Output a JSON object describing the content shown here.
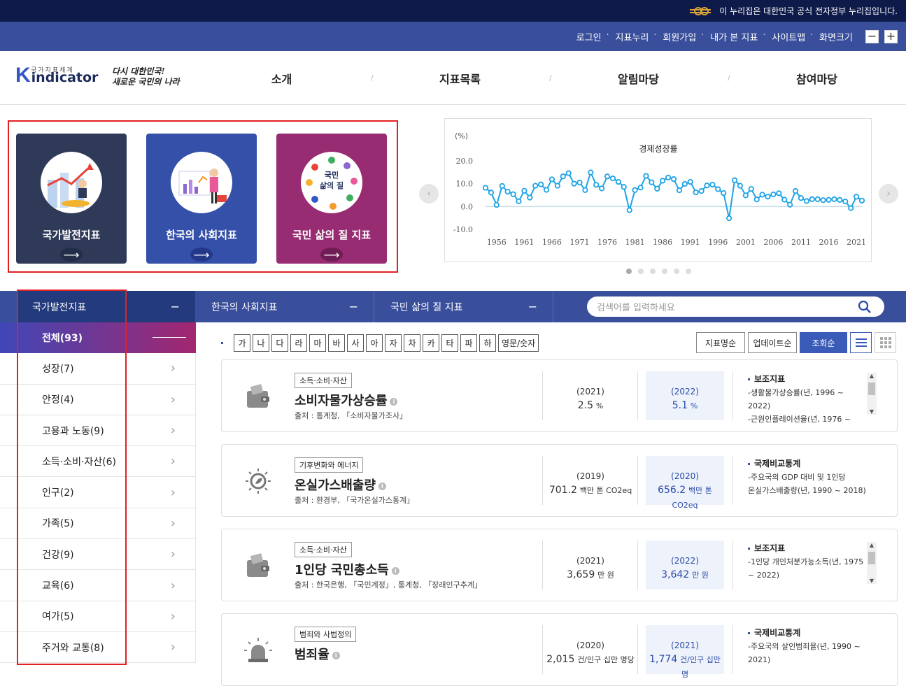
{
  "topbar": {
    "notice": "이 누리집은 대한민국 공식 전자정부 누리집입니다."
  },
  "util": {
    "links": [
      "로그인",
      "지표누리",
      "회원가입",
      "내가 본 지표",
      "사이트맵",
      "화면크기"
    ],
    "zoom_out": "−",
    "zoom_in": "+"
  },
  "header": {
    "logo_sub": "국가지표체계",
    "logo_k": "K",
    "logo_name": "indicator",
    "slogan_1": "다시 대한민국!",
    "slogan_2": "새로운 국민의 나라",
    "nav": [
      "소개",
      "지표목록",
      "알림마당",
      "참여마당"
    ]
  },
  "cards": [
    {
      "title": "국가발전지표",
      "color": "#2f3a58"
    },
    {
      "title": "한국의 사회지표",
      "color": "#3450a8"
    },
    {
      "title": "국민 삶의 질 지표",
      "color": "#972c72",
      "circle_text_1": "국민",
      "circle_text_2": "삶의 질"
    }
  ],
  "chart_data": {
    "type": "line",
    "title": "경제성장률",
    "ylabel": "(%)",
    "ylim": [
      -10,
      20
    ],
    "yticks": [
      "20.0",
      "10.0",
      "0.0",
      "-10.0"
    ],
    "xticks": [
      "1956",
      "1961",
      "1966",
      "1971",
      "1976",
      "1981",
      "1986",
      "1991",
      "1996",
      "2001",
      "2006",
      "2011",
      "2016",
      "2021"
    ],
    "x": [
      1954,
      1955,
      1956,
      1957,
      1958,
      1959,
      1960,
      1961,
      1962,
      1963,
      1964,
      1965,
      1966,
      1967,
      1968,
      1969,
      1970,
      1971,
      1972,
      1973,
      1974,
      1975,
      1976,
      1977,
      1978,
      1979,
      1980,
      1981,
      1982,
      1983,
      1984,
      1985,
      1986,
      1987,
      1988,
      1989,
      1990,
      1991,
      1992,
      1993,
      1994,
      1995,
      1996,
      1997,
      1998,
      1999,
      2000,
      2001,
      2002,
      2003,
      2004,
      2005,
      2006,
      2007,
      2008,
      2009,
      2010,
      2011,
      2012,
      2013,
      2014,
      2015,
      2016,
      2017,
      2018,
      2019,
      2020,
      2021,
      2022
    ],
    "values": [
      8.2,
      6.1,
      0.7,
      9.0,
      6.5,
      5.4,
      2.3,
      6.9,
      3.9,
      9.1,
      9.7,
      7.3,
      11.9,
      9.1,
      13.2,
      14.6,
      10.0,
      10.5,
      7.2,
      14.9,
      9.5,
      7.9,
      13.2,
      12.3,
      10.8,
      8.6,
      -1.6,
      7.2,
      8.3,
      13.4,
      10.6,
      7.8,
      11.3,
      12.7,
      12.0,
      7.1,
      9.9,
      10.8,
      6.2,
      6.8,
      9.2,
      9.6,
      7.6,
      5.9,
      -5.1,
      11.5,
      9.1,
      4.9,
      7.7,
      3.1,
      5.2,
      4.3,
      5.3,
      5.8,
      3.0,
      0.8,
      6.8,
      3.7,
      2.4,
      3.2,
      3.2,
      2.8,
      2.9,
      3.2,
      2.9,
      2.2,
      -0.7,
      4.3,
      2.6
    ],
    "color": "#1ea3e6",
    "slides": 6,
    "active_slide": 0
  },
  "tabs": [
    {
      "label": "국가발전지표",
      "icon": "−"
    },
    {
      "label": "한국의 사회지표",
      "icon": "−"
    },
    {
      "label": "국민 삶의 질 지표",
      "icon": "−"
    }
  ],
  "search": {
    "placeholder": "검색어를 입력하세요"
  },
  "sidebar": {
    "items": [
      "전체(93)",
      "성장(7)",
      "안정(4)",
      "고용과 노동(9)",
      "소득·소비·자산(6)",
      "인구(2)",
      "가족(5)",
      "건강(9)",
      "교육(6)",
      "여가(5)",
      "주거와 교통(8)"
    ]
  },
  "alpha": [
    "가",
    "나",
    "다",
    "라",
    "마",
    "바",
    "사",
    "아",
    "자",
    "차",
    "카",
    "타",
    "파",
    "하",
    "영문/숫자"
  ],
  "sort": {
    "name": "지표명순",
    "update": "업데이트순",
    "views": "조회순"
  },
  "items": [
    {
      "category": "소득·소비·자산",
      "name": "소비자물가상승률",
      "source": "출처 : 통계청, 「소비자물가조사」",
      "prev_year": "(2021)",
      "prev_num": "2.5",
      "prev_unit": "%",
      "cur_year": "(2022)",
      "cur_num": "5.1",
      "cur_unit": "%",
      "side_title": "보조지표",
      "side_lines": [
        "-생활물가상승률(년, 1996 ~ 2022)",
        "-근원인플레이션율(년, 1976 ~"
      ],
      "icon": "wallet-icon",
      "scroll": true
    },
    {
      "category": "기후변화와 에너지",
      "name": "온실가스배출량",
      "source": "출처 : 환경부, 「국가온실가스통계」",
      "prev_year": "(2019)",
      "prev_num": "701.2",
      "prev_unit": "백만 톤 CO2eq",
      "cur_year": "(2020)",
      "cur_num": "656.2",
      "cur_unit": "백만 톤 CO2eq",
      "side_title": "국제비교통계",
      "side_lines": [
        "-주요국의 GDP 대비 및 1인당",
        "온실가스배출량(년, 1990 ~ 2018)"
      ],
      "icon": "sun-leaf-icon",
      "scroll": false
    },
    {
      "category": "소득·소비·자산",
      "name": "1인당 국민총소득",
      "source": "출처 : 한국은행, 「국민계정」, 통계청, 「장래인구추계」",
      "prev_year": "(2021)",
      "prev_num": "3,659",
      "prev_unit": "만 원",
      "cur_year": "(2022)",
      "cur_num": "3,642",
      "cur_unit": "만 원",
      "side_title": "보조지표",
      "side_lines": [
        "-1인당 개인처분가능소득(년, 1975",
        "~ 2022)"
      ],
      "icon": "wallet-icon",
      "scroll": true
    },
    {
      "category": "범죄와 사법정의",
      "name": "범죄율",
      "source": "",
      "prev_year": "(2020)",
      "prev_num": "2,015",
      "prev_unit": "건/인구 십만 명당",
      "cur_year": "(2021)",
      "cur_num": "1,774",
      "cur_unit": "건/인구 십만 명",
      "side_title": "국제비교통계",
      "side_lines": [
        "-주요국의 살인범죄율(년, 1990 ~",
        "2021)"
      ],
      "icon": "siren-icon",
      "scroll": false
    }
  ]
}
